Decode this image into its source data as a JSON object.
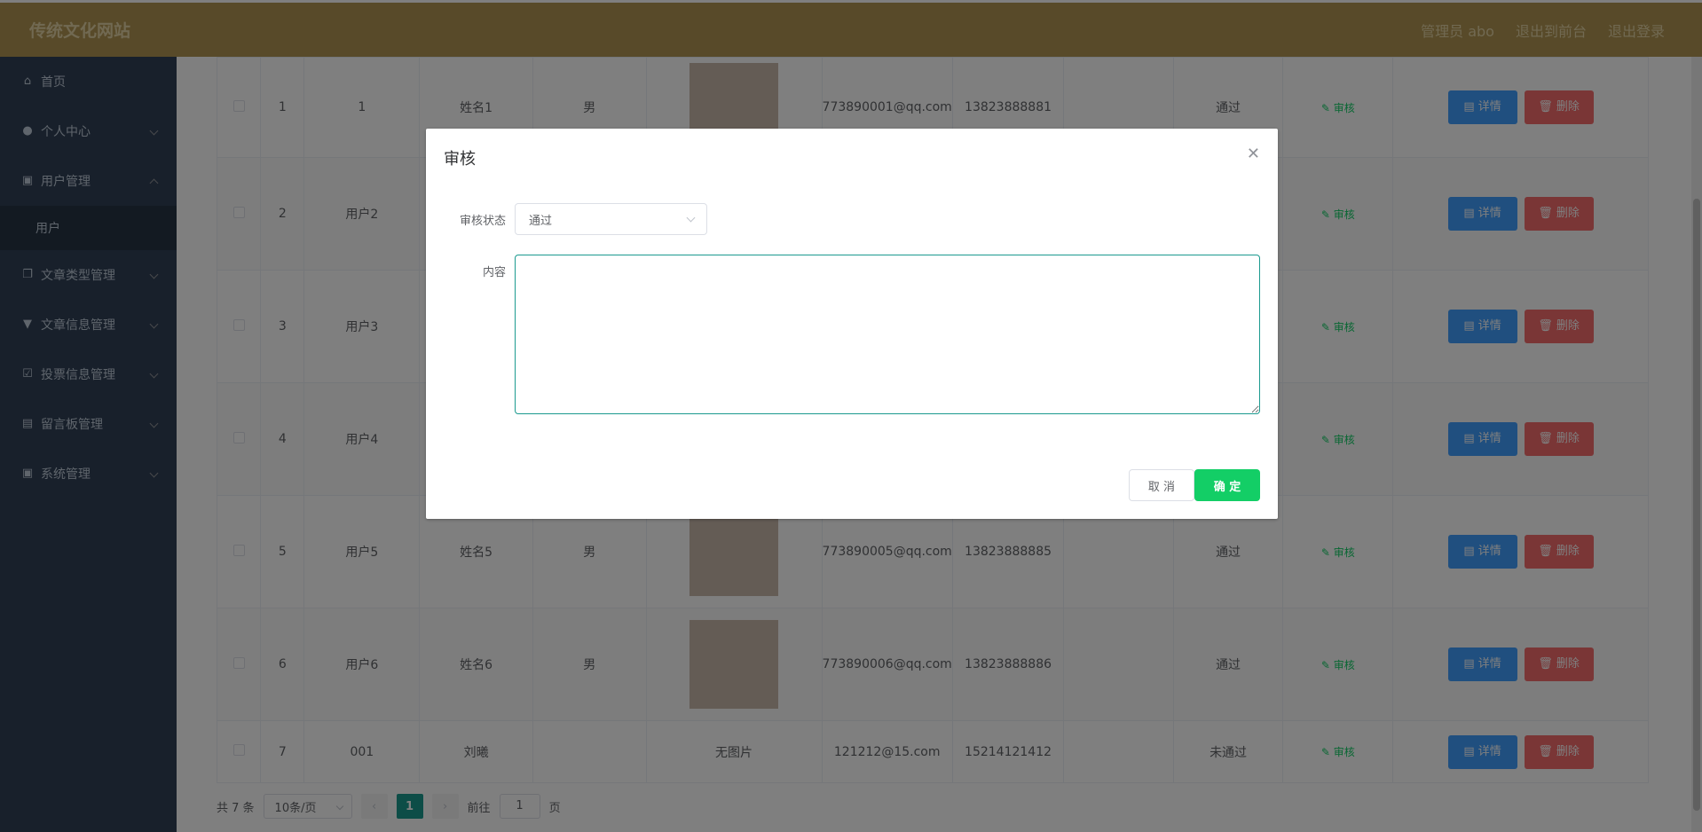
{
  "header": {
    "brand": "传统文化网站",
    "admin_label": "管理员 abo",
    "to_front": "退出到前台",
    "logout": "退出登录"
  },
  "sidebar": {
    "items": [
      {
        "label": "首页",
        "icon": "home-icon"
      },
      {
        "label": "个人中心",
        "icon": "user-icon"
      },
      {
        "label": "用户管理",
        "icon": "lock-icon"
      },
      {
        "label": "用户",
        "icon": ""
      },
      {
        "label": "文章类型管理",
        "icon": "copy-icon"
      },
      {
        "label": "文章信息管理",
        "icon": "trophy-icon"
      },
      {
        "label": "投票信息管理",
        "icon": "vote-icon"
      },
      {
        "label": "留言板管理",
        "icon": "printer-icon"
      },
      {
        "label": "系统管理",
        "icon": "lock-icon"
      }
    ]
  },
  "table": {
    "rows": [
      {
        "index": "1",
        "account": "1",
        "name": "姓名1",
        "gender": "男",
        "photo": "photo",
        "email": "773890001@qq.com",
        "phone": "13823888881",
        "status": "通过"
      },
      {
        "index": "2",
        "account": "用户2",
        "name": "",
        "gender": "",
        "photo": "",
        "email": "",
        "phone": "",
        "status": ""
      },
      {
        "index": "3",
        "account": "用户3",
        "name": "",
        "gender": "",
        "photo": "",
        "email": "",
        "phone": "",
        "status": ""
      },
      {
        "index": "4",
        "account": "用户4",
        "name": "",
        "gender": "",
        "photo": "",
        "email": "",
        "phone": "",
        "status": ""
      },
      {
        "index": "5",
        "account": "用户5",
        "name": "姓名5",
        "gender": "男",
        "photo": "photo",
        "email": "773890005@qq.com",
        "phone": "13823888885",
        "status": "通过"
      },
      {
        "index": "6",
        "account": "用户6",
        "name": "姓名6",
        "gender": "男",
        "photo": "photo",
        "email": "773890006@qq.com",
        "phone": "13823888886",
        "status": "通过"
      },
      {
        "index": "7",
        "account": "001",
        "name": "刘曦",
        "gender": "",
        "photo": "无图片",
        "email": "121212@15.com",
        "phone": "15214121412",
        "status": "未通过"
      }
    ],
    "audit_label": "审核",
    "detail_label": "详情",
    "delete_label": "删除"
  },
  "pager": {
    "total": "共 7 条",
    "page_size": "10条/页",
    "current": "1",
    "goto_label": "前往",
    "goto_value": "1",
    "page_suffix": "页"
  },
  "dialog": {
    "title": "审核",
    "status_label": "审核状态",
    "status_value": "通过",
    "content_label": "内容",
    "content_value": "",
    "cancel": "取 消",
    "confirm": "确 定"
  }
}
